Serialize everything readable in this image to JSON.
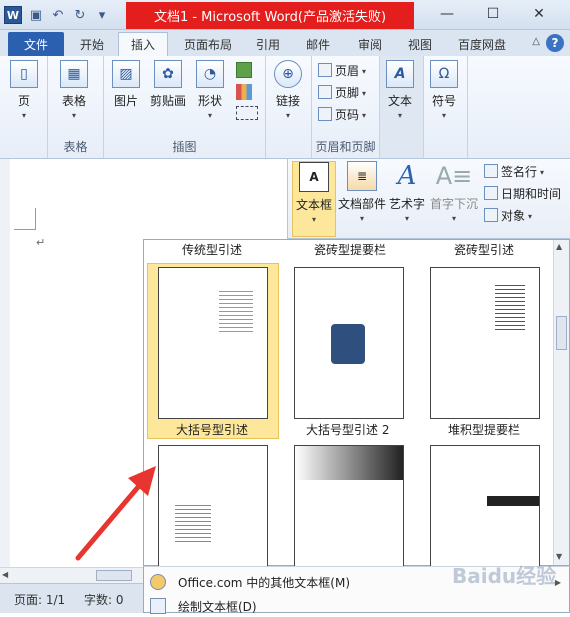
{
  "app": {
    "title": "文档1 - Microsoft Word(产品激活失败)"
  },
  "tabs": [
    {
      "label": "文件"
    },
    {
      "label": "开始"
    },
    {
      "label": "插入"
    },
    {
      "label": "页面布局"
    },
    {
      "label": "引用"
    },
    {
      "label": "邮件"
    },
    {
      "label": "审阅"
    },
    {
      "label": "视图"
    },
    {
      "label": "百度网盘"
    }
  ],
  "ribbon": {
    "page": "页",
    "table": "表格",
    "table_group": "表格",
    "picture": "图片",
    "clipart": "剪贴画",
    "shapes": "形状",
    "illustrations_group": "插图",
    "link": "链接",
    "header": "页眉",
    "footer": "页脚",
    "pagenum": "页码",
    "hf_group": "页眉和页脚",
    "textbox": "文本",
    "symbol": "符号"
  },
  "text_group": {
    "textbox": "文本框",
    "quickparts": "文档部件",
    "wordart": "艺术字",
    "dropcap": "首字下沉",
    "signature": "签名行",
    "datetime": "日期和时间",
    "object": "对象"
  },
  "gallery": {
    "headers": [
      "传统型引述",
      "瓷砖型提要栏",
      "瓷砖型引述"
    ],
    "items": [
      "大括号型引述",
      "大括号型引述 2",
      "堆积型提要栏"
    ]
  },
  "menu": {
    "more": "Office.com 中的其他文本框(M)",
    "draw": "绘制文本框(D)"
  },
  "status": {
    "page": "页面: 1/1",
    "words": "字数: 0"
  },
  "colors": {
    "title_red": "#e41d1d",
    "file_tab": "#2b5fb0",
    "selection": "#fde79a"
  }
}
